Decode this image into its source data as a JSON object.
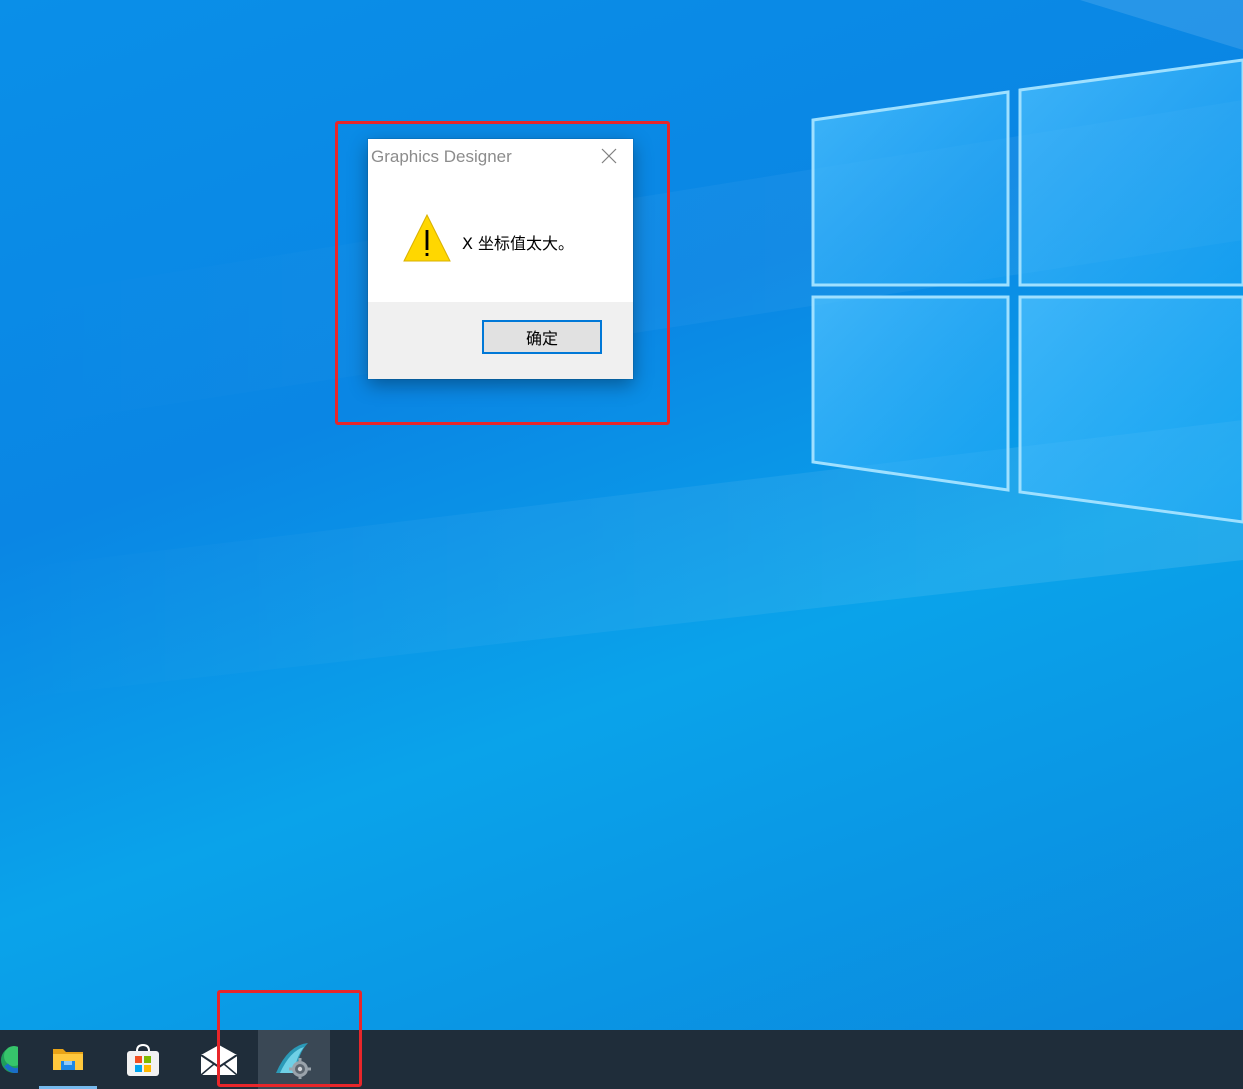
{
  "dialog": {
    "title": "Graphics Designer",
    "close_glyph": "✕",
    "icon": "warning-icon",
    "message": "X 坐标值太大。",
    "ok_label": "确定"
  },
  "taskbar": {
    "items": [
      {
        "name": "edge-icon",
        "active": false
      },
      {
        "name": "file-explorer-icon",
        "active": false,
        "underlined": true
      },
      {
        "name": "microsoft-store-icon",
        "active": false
      },
      {
        "name": "mail-icon",
        "active": false
      },
      {
        "name": "graphics-designer-icon",
        "active": true
      }
    ]
  },
  "annotations": {
    "color": "#e8262a"
  },
  "colors": {
    "desktop": "#0a8fe8",
    "taskbar": "#1f2d3a",
    "dialog_footer": "#f0f0f0",
    "button_border": "#0078d7"
  }
}
